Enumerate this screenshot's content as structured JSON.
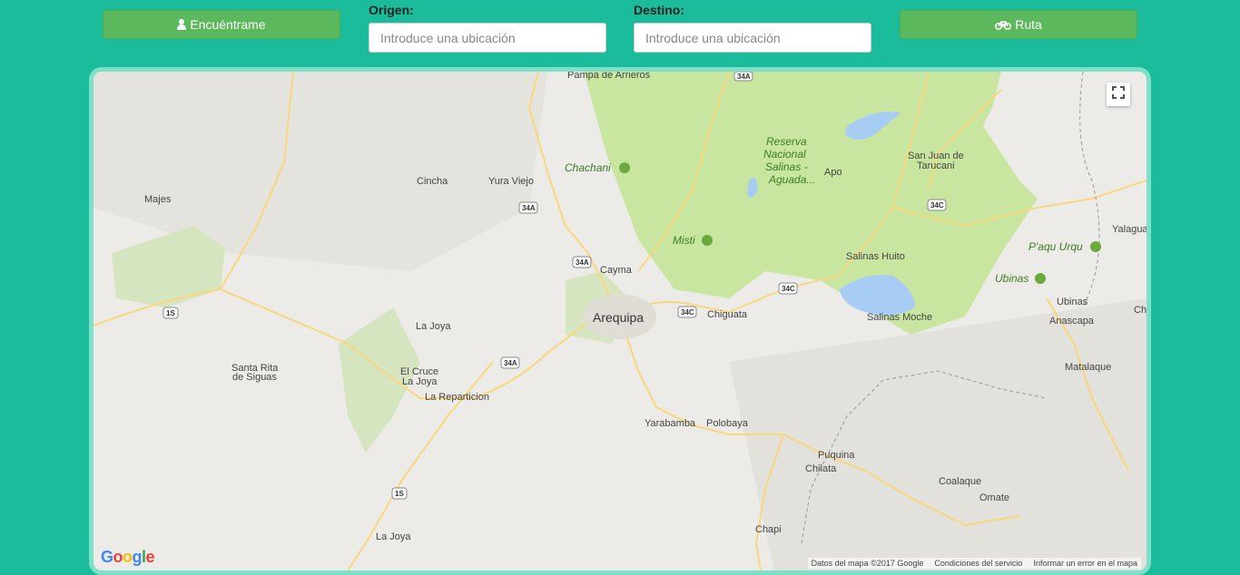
{
  "buttons": {
    "find": "Encuéntrame",
    "route": "Ruta"
  },
  "origin": {
    "label": "Origen:",
    "placeholder": "Introduce una ubicación"
  },
  "destination": {
    "label": "Destino:",
    "placeholder": "Introduce una ubicación"
  },
  "map": {
    "places": [
      "Pampa de Arrieros",
      "Cincha",
      "Yura Viejo",
      "Majes",
      "Cayma",
      "Arequipa",
      "Chiguata",
      "La Joya",
      "Santa Rita",
      "de Siguas",
      "El Cruce",
      "La Joya",
      "La Reparticion",
      "Yarabamba",
      "Polobaya",
      "Puquina",
      "Chilata",
      "Coalaque",
      "Omate",
      "Chapi",
      "La Joya",
      "Apo",
      "San Juan de",
      "Tarucani",
      "Salinas Huito",
      "Salinas Moche",
      "Ubinas",
      "Anascapa",
      "Matalaque",
      "Yalagua",
      "Ch"
    ],
    "parks": [
      "Chachani",
      "Misti",
      "Reserva",
      "Nacional",
      "Salinas -",
      "Aguada...",
      "P'aqu Urqu",
      "Ubinas"
    ],
    "roads": [
      "34A",
      "34A",
      "34A",
      "34A",
      "34C",
      "34C",
      "34C",
      "1S",
      "1S"
    ],
    "footer": [
      "Datos del mapa ©2017 Google",
      "Condiciones del servicio",
      "Informar un error en el mapa"
    ],
    "logo": "Google",
    "colors": {
      "park": "#c8e6a0",
      "water": "#a8cdf4",
      "road": "#f9d77e",
      "land": "#ecebe7"
    }
  }
}
